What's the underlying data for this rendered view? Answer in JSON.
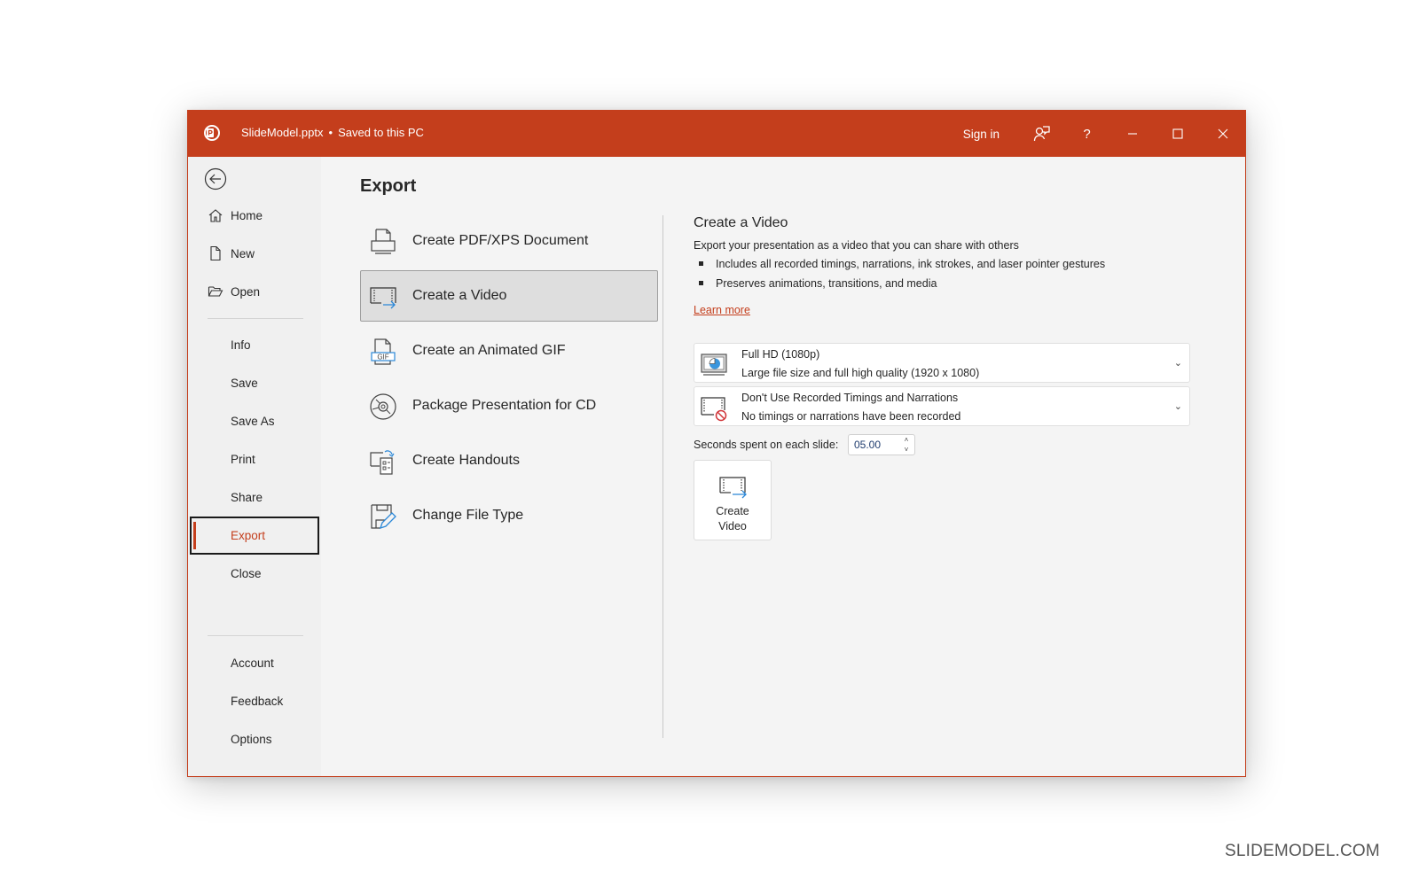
{
  "titlebar": {
    "filename": "SlideModel.pptx",
    "separator": "•",
    "save_status": "Saved to this PC",
    "sign_in": "Sign in",
    "icons": [
      "powerpoint-logo-icon",
      "feedback-icon",
      "help-icon",
      "minimize-icon",
      "maximize-icon",
      "close-icon"
    ],
    "help_glyph": "?"
  },
  "colors": {
    "accent": "#c43e1c",
    "background": "#f3f3f3",
    "sidebar": "#f0f0f0",
    "link": "#c43e1c",
    "selected_option": "#dedede"
  },
  "sidebar": {
    "back_icon": "back-arrow-icon",
    "items": [
      {
        "label": "Home",
        "icon": "home-icon"
      },
      {
        "label": "New",
        "icon": "new-document-icon"
      },
      {
        "label": "Open",
        "icon": "folder-open-icon"
      },
      {
        "label": "Info"
      },
      {
        "label": "Save"
      },
      {
        "label": "Save As"
      },
      {
        "label": "Print"
      },
      {
        "label": "Share"
      },
      {
        "label": "Export",
        "active": true
      },
      {
        "label": "Close"
      },
      {
        "label": "Account"
      },
      {
        "label": "Feedback"
      },
      {
        "label": "Options"
      }
    ]
  },
  "main": {
    "title": "Export",
    "options": [
      {
        "label": "Create PDF/XPS Document",
        "icon": "pdf-document-icon"
      },
      {
        "label": "Create a Video",
        "icon": "video-export-icon",
        "selected": true
      },
      {
        "label": "Create an Animated GIF",
        "icon": "gif-icon"
      },
      {
        "label": "Package Presentation for CD",
        "icon": "cd-icon"
      },
      {
        "label": "Create Handouts",
        "icon": "handouts-icon"
      },
      {
        "label": "Change File Type",
        "icon": "change-file-type-icon"
      }
    ]
  },
  "detail": {
    "title": "Create a Video",
    "description": "Export your presentation as a video that you can share with others",
    "bullets": [
      "Includes all recorded timings, narrations, ink strokes, and laser pointer gestures",
      "Preserves animations, transitions, and media"
    ],
    "learn_more": "Learn more",
    "quality_dropdown": {
      "selected_title": "Full HD (1080p)",
      "selected_subtitle": "Large file size and full high quality (1920 x 1080)",
      "icon": "monitor-quality-icon"
    },
    "timings_dropdown": {
      "selected_title": "Don't Use Recorded Timings and Narrations",
      "selected_subtitle": "No timings or narrations have been recorded",
      "icon": "no-timings-icon"
    },
    "chevron": "⌄",
    "seconds_label": "Seconds spent on each slide:",
    "seconds_value": "05.00",
    "spin_up": "˄",
    "spin_down": "˅",
    "create_button": "Create Video"
  },
  "watermark": "SLIDEMODEL.COM"
}
